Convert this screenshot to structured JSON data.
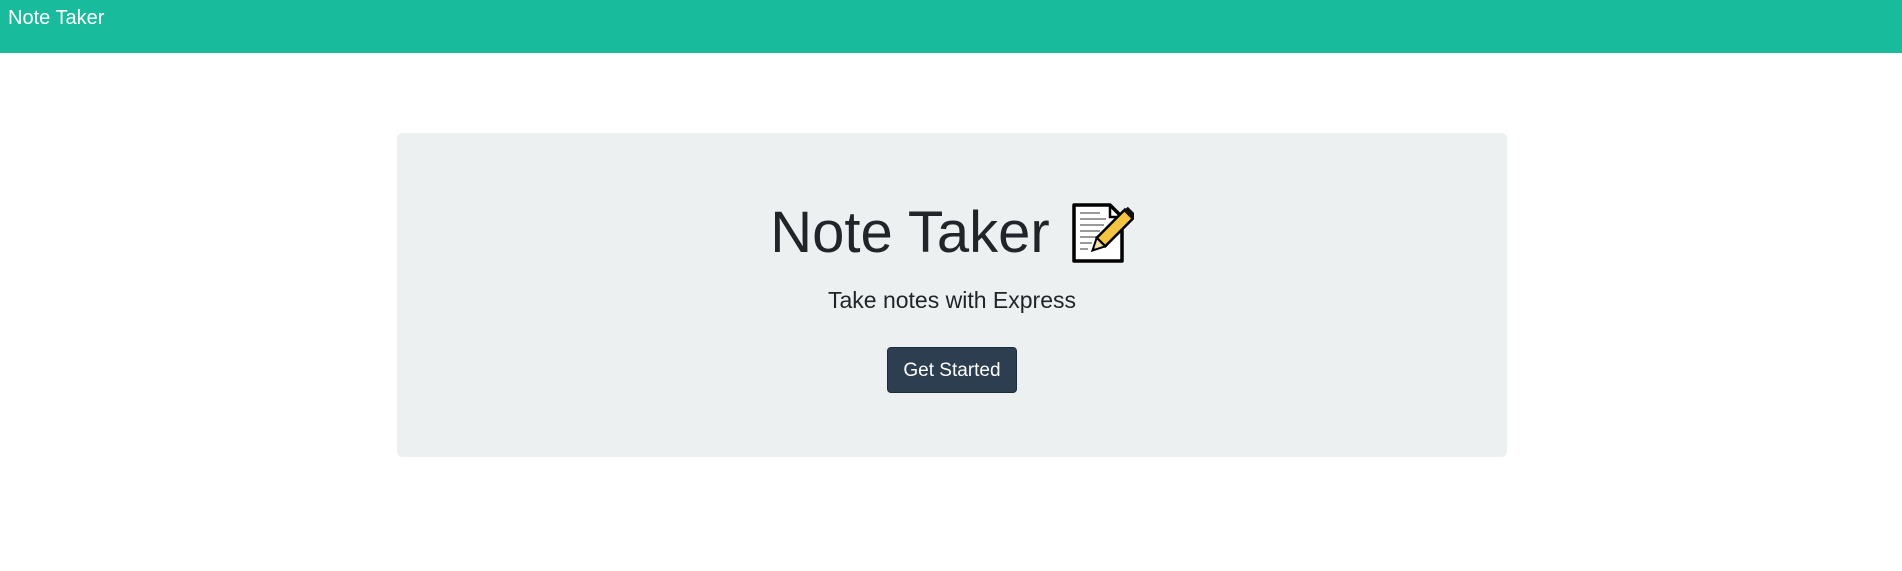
{
  "navbar": {
    "brand": "Note Taker",
    "background_color": "#18bc9c"
  },
  "hero": {
    "title": "Note Taker",
    "icon": "memo-icon",
    "subtitle": "Take notes with Express",
    "cta_label": "Get Started",
    "background_color": "#ecf0f1",
    "button_color": "#2c3e50"
  }
}
